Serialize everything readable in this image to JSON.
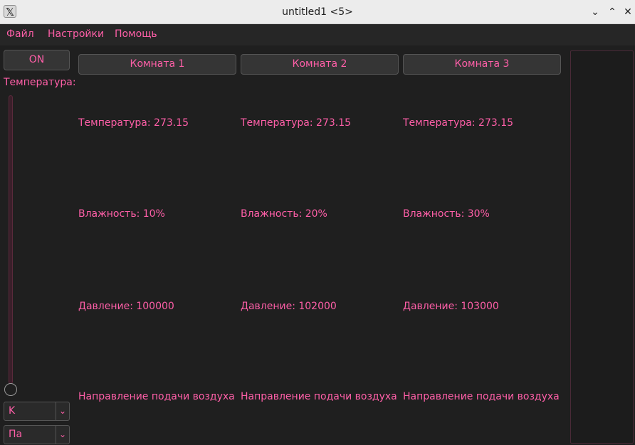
{
  "window": {
    "title": "untitled1 <5>",
    "app_icon": "𝕏",
    "minimize": "⌄",
    "maximize": "⌃",
    "close": "✕"
  },
  "menu": {
    "file": "Файл",
    "settings": "Настройки",
    "help": "Помощь"
  },
  "controls": {
    "on_label": "ON",
    "temperature_label": "Температура:",
    "temp_unit": "K",
    "pressure_unit": "Па",
    "dropdown_arrow": "⌄"
  },
  "rooms": [
    {
      "name": "Комната 1",
      "temperature": "Температура: 273.15",
      "humidity": "Влажность: 10%",
      "pressure": "Давление: 100000",
      "air_direction": "Направление подачи воздуха"
    },
    {
      "name": "Комната 2",
      "temperature": "Температура: 273.15",
      "humidity": "Влажность: 20%",
      "pressure": "Давление: 102000",
      "air_direction": "Направление подачи воздуха"
    },
    {
      "name": "Комната 3",
      "temperature": "Температура: 273.15",
      "humidity": "Влажность: 30%",
      "pressure": "Давление: 103000",
      "air_direction": "Направление подачи воздуха"
    }
  ],
  "colors": {
    "accent_text": "#ff5fa8",
    "background": "#1f1f1f",
    "titlebar": "#ececec"
  }
}
